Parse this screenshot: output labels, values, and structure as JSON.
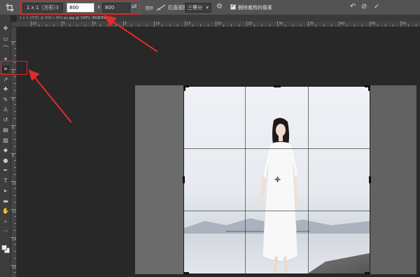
{
  "options_bar": {
    "ratio_preset": "1 x 1（方形）",
    "width_value": "800",
    "times_sign": "x",
    "height_value": "800",
    "clear_label": "清除",
    "straighten_label": "拉直",
    "view_label": "视图:",
    "view_value": "三等分",
    "delete_pixels_label": "删除裁剪的像素",
    "delete_pixels_checked": true
  },
  "document_tab": {
    "text_dim": "1 x 1 (方形) @ 800 x 800 ",
    "text_highlight": "px  jpg @ 100% (RGB/8#) ×"
  },
  "ruler_top_ticks": [
    "10",
    "5",
    "0",
    "5",
    "10",
    "15",
    "20",
    "25",
    "30",
    "35",
    "40",
    "45",
    "50"
  ],
  "ruler_left_ticks": [
    "0",
    "2",
    "4",
    "6",
    "8",
    "10",
    "12",
    "14",
    "16"
  ],
  "toolbox": {
    "tools": [
      {
        "name": "move-tool",
        "glyph": "✥"
      },
      {
        "name": "marquee-tool",
        "glyph": "▭"
      },
      {
        "name": "lasso-tool",
        "glyph": "⌒"
      },
      {
        "name": "quick-select-tool",
        "glyph": "✶"
      },
      {
        "name": "crop-tool",
        "glyph": "⌗",
        "active": true
      },
      {
        "name": "eyedropper-tool",
        "glyph": "↗"
      },
      {
        "name": "healing-tool",
        "glyph": "✚"
      },
      {
        "name": "brush-tool",
        "glyph": "✎"
      },
      {
        "name": "stamp-tool",
        "glyph": "♙"
      },
      {
        "name": "history-brush-tool",
        "glyph": "↺"
      },
      {
        "name": "eraser-tool",
        "glyph": "▤"
      },
      {
        "name": "gradient-tool",
        "glyph": "▨"
      },
      {
        "name": "blur-tool",
        "glyph": "◆"
      },
      {
        "name": "dodge-tool",
        "glyph": "●"
      },
      {
        "name": "pen-tool",
        "glyph": "✒"
      },
      {
        "name": "type-tool",
        "glyph": "T"
      },
      {
        "name": "path-select-tool",
        "glyph": "▸"
      },
      {
        "name": "shape-tool",
        "glyph": "▬"
      },
      {
        "name": "hand-tool",
        "glyph": "✋"
      },
      {
        "name": "zoom-tool",
        "glyph": "⌕"
      },
      {
        "name": "extra-tools",
        "glyph": "···"
      }
    ]
  },
  "colors": {
    "annotation_red": "#e12b2b",
    "panel_bg": "#535353",
    "canvas_bg": "#282828"
  }
}
